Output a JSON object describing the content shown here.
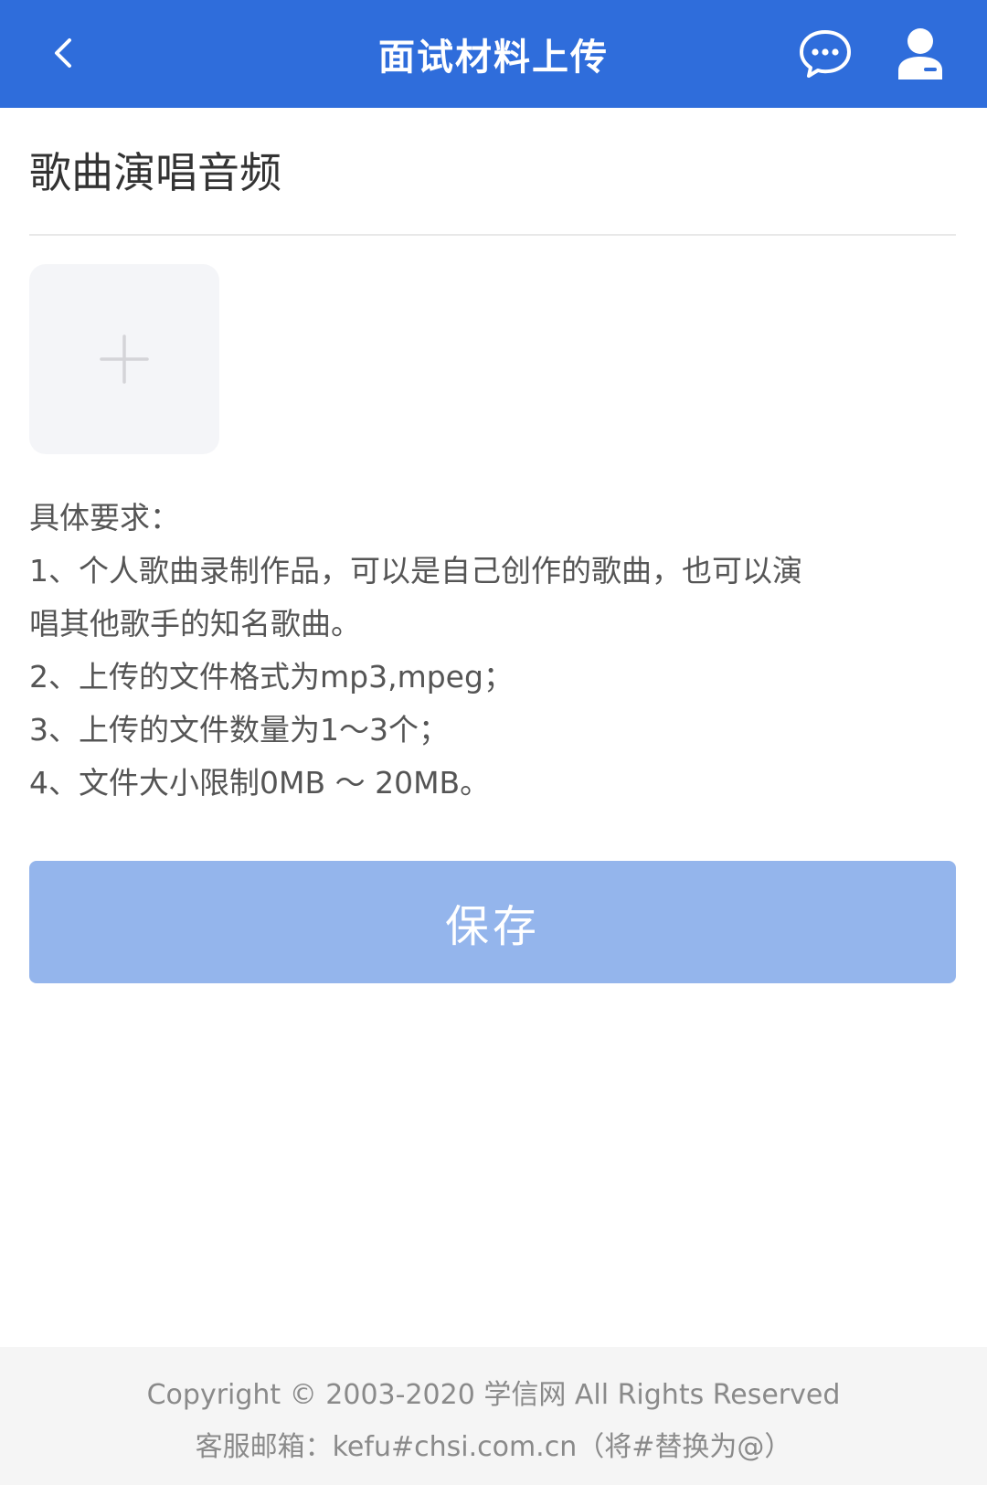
{
  "header": {
    "title": "面试材料上传",
    "back_icon": "chevron-left-icon",
    "message_icon": "chat-bubble-icon",
    "user_icon": "user-icon",
    "background_color": "#2f6ddb"
  },
  "section": {
    "title": "歌曲演唱音频"
  },
  "upload": {
    "icon": "plus-icon"
  },
  "requirements": {
    "heading": "具体要求：",
    "lines": [
      "1、个人歌曲录制作品，可以是自己创作的歌曲，也可以演",
      "唱其他歌手的知名歌曲。",
      "2、上传的文件格式为mp3,mpeg；",
      "3、上传的文件数量为1～3个；",
      "4、文件大小限制0MB ～ 20MB。"
    ]
  },
  "save_button": {
    "label": "保存",
    "color": "#94b5ec"
  },
  "footer": {
    "copyright": "Copyright © 2003-2020 学信网 All Rights Reserved",
    "contact": "客服邮箱：kefu#chsi.com.cn（将#替换为@）"
  }
}
